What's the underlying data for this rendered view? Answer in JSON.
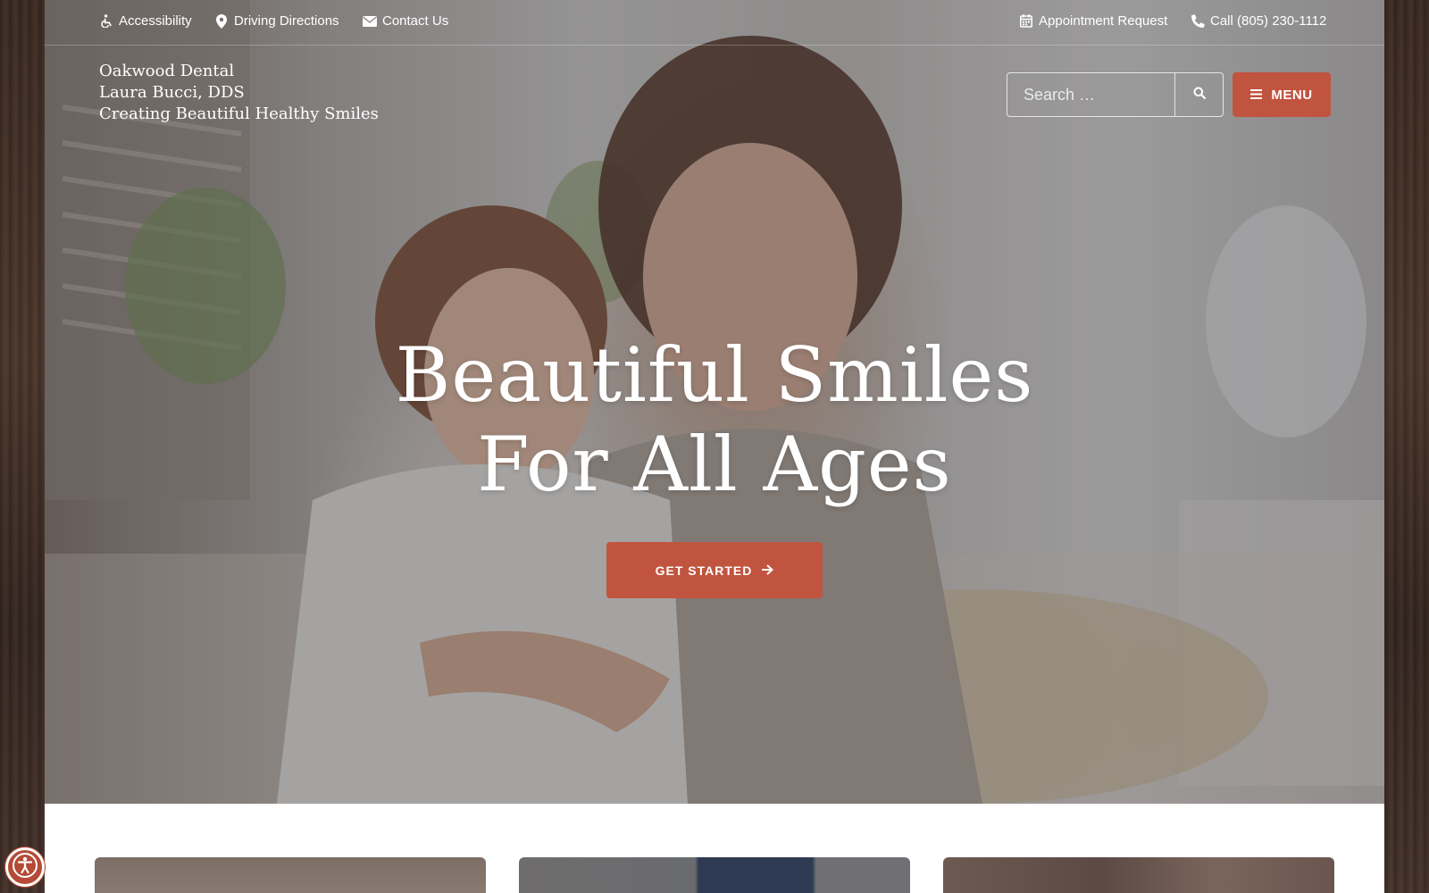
{
  "topbar": {
    "left_links": [
      {
        "label": "Accessibility",
        "icon": "wheelchair-icon"
      },
      {
        "label": "Driving Directions",
        "icon": "map-marker-icon"
      },
      {
        "label": "Contact Us",
        "icon": "envelope-icon"
      }
    ],
    "right_links": [
      {
        "label": "Appointment Request",
        "icon": "calendar-icon"
      },
      {
        "label": "Call (805) 230-1112",
        "icon": "phone-icon"
      }
    ]
  },
  "logo": {
    "line1": "Oakwood Dental",
    "line2": "Laura Bucci, DDS",
    "line3": "Creating Beautiful Healthy Smiles"
  },
  "search": {
    "placeholder": "Search …",
    "icon": "search-icon"
  },
  "menu": {
    "label": "MENU",
    "icon": "hamburger-icon"
  },
  "hero": {
    "headline_line1": "Beautiful Smiles",
    "headline_line2": "For All Ages",
    "cta_label": "GET STARTED",
    "cta_icon": "arrow-right-icon"
  },
  "accessibility_widget": {
    "icon": "accessibility-icon"
  },
  "colors": {
    "accent": "#c1543f",
    "text_light": "#ffffff"
  }
}
